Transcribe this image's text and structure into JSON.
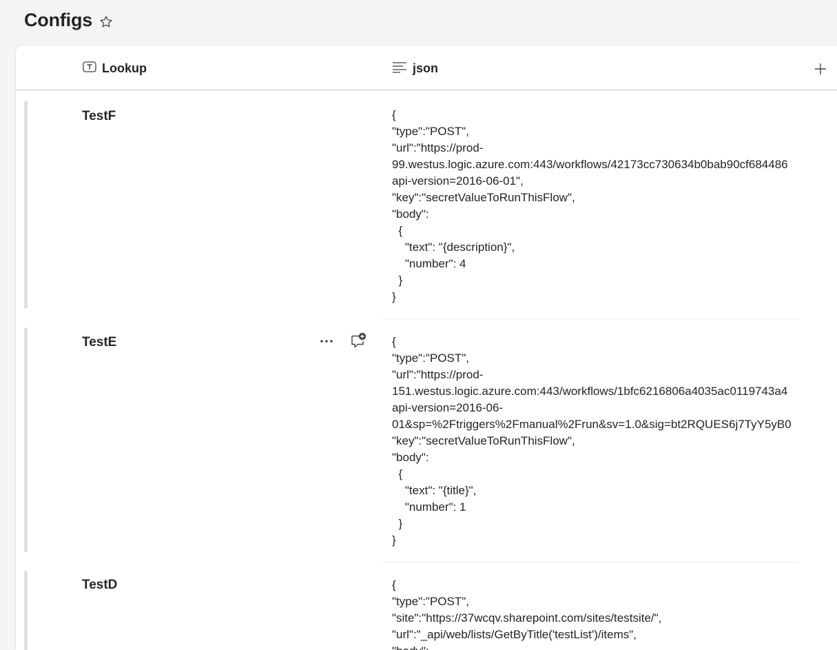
{
  "page": {
    "title": "Configs"
  },
  "columns": {
    "lookup": "Lookup",
    "json": "json"
  },
  "rows": [
    {
      "title": "TestF",
      "json": "{\n\"type\":\"POST\",\n\"url\":\"https://prod-\n99.westus.logic.azure.com:443/workflows/42173cc730634b0bab90cf684486\napi-version=2016-06-01\",\n\"key\":\"secretValueToRunThisFlow\",\n\"body\":\n  {\n    \"text\": \"{description}\",\n    \"number\": 4\n  }\n}"
    },
    {
      "title": "TestE",
      "json": "{\n\"type\":\"POST\",\n\"url\":\"https://prod-\n151.westus.logic.azure.com:443/workflows/1bfc6216806a4035ac0119743a4\napi-version=2016-06-\n01&sp=%2Ftriggers%2Fmanual%2Frun&sv=1.0&sig=bt2RQUES6j7TyY5yB0\n\"key\":\"secretValueToRunThisFlow\",\n\"body\":\n  {\n    \"text\": \"{title}\",\n    \"number\": 1\n  }\n}"
    },
    {
      "title": "TestD",
      "json": "{\n\"type\":\"POST\",\n\"site\":\"https://37wcqv.sharepoint.com/sites/testsite/\",\n\"url\":\"_api/web/lists/GetByTitle('testList')/items\",\n\"body\":"
    }
  ],
  "icons": {
    "favorite": "star-outline-icon",
    "text_column": "text-column-icon",
    "multiline_column": "multiline-text-icon",
    "add_column": "plus-icon",
    "more": "more-horizontal-icon",
    "comment": "add-comment-icon"
  }
}
